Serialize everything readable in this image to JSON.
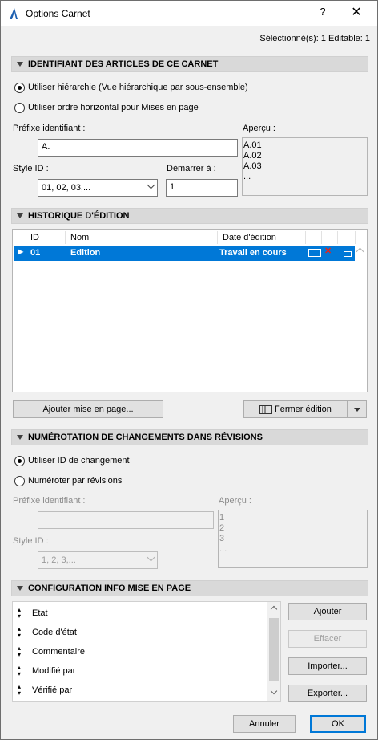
{
  "window": {
    "title": "Options Carnet",
    "help_glyph": "?",
    "close_glyph": "✕",
    "selection_info": "Sélectionné(s): 1 Editable: 1"
  },
  "ident": {
    "header": "IDENTIFIANT DES ARTICLES DE CE CARNET",
    "radio_hierarchy": "Utiliser hiérarchie (Vue hiérarchique par sous-ensemble)",
    "radio_horizontal": "Utiliser ordre horizontal pour Mises en page",
    "prefix_label": "Préfixe identifiant :",
    "prefix_value": "A.",
    "style_label": "Style ID :",
    "style_value": "01, 02, 03,...",
    "start_label": "Démarrer à :",
    "start_value": "1",
    "preview_label": "Aperçu :",
    "preview_lines": [
      "A.01",
      "A.02",
      "A.03",
      "..."
    ]
  },
  "history": {
    "header": "HISTORIQUE D'ÉDITION",
    "columns": [
      "ID",
      "Nom",
      "Date d'édition"
    ],
    "rows": [
      {
        "id": "01",
        "name": "Edition",
        "date": "Travail en cours"
      }
    ],
    "add_layout_button": "Ajouter mise en page...",
    "close_edition_button": "Fermer édition"
  },
  "numbering": {
    "header": "NUMÉROTATION DE CHANGEMENTS DANS RÉVISIONS",
    "radio_change_id": "Utiliser ID de changement",
    "radio_by_revision": "Numéroter par révisions",
    "prefix_label": "Préfixe identifiant :",
    "prefix_value": "",
    "style_label": "Style ID :",
    "style_value": "1, 2, 3,...",
    "preview_label": "Aperçu :",
    "preview_lines": [
      "1",
      "2",
      "3",
      "..."
    ]
  },
  "layout_info": {
    "header": "CONFIGURATION INFO MISE EN PAGE",
    "items": [
      "Etat",
      "Code d'état",
      "Commentaire",
      "Modifié par",
      "Vérifié par"
    ],
    "add_button": "Ajouter",
    "delete_button": "Effacer",
    "import_button": "Importer...",
    "export_button": "Exporter..."
  },
  "footer": {
    "cancel_button": "Annuler",
    "ok_button": "OK"
  },
  "colors": {
    "selection_blue": "#0078d7",
    "section_gray": "#d9d9d9",
    "delete_red": "#e0261e"
  }
}
